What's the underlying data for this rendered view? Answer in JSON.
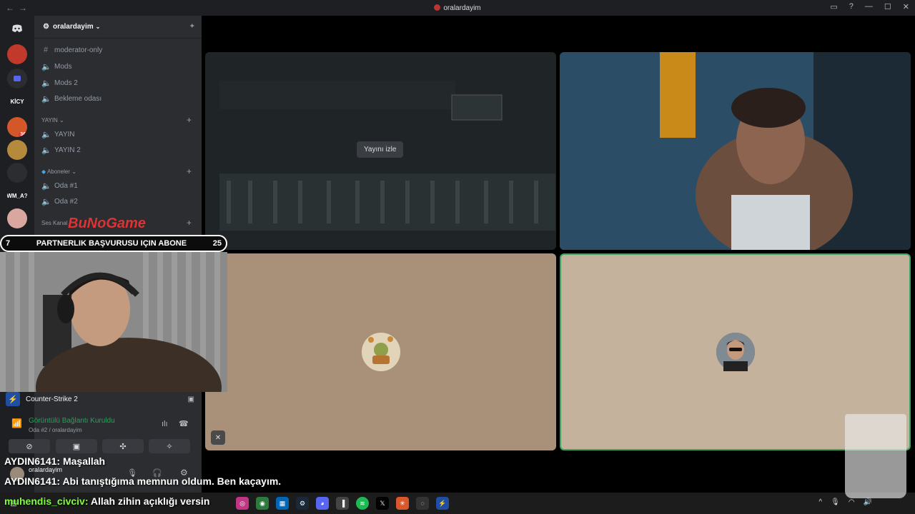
{
  "window": {
    "title": "oralardayim"
  },
  "server": {
    "name": "oralardayim"
  },
  "guilds": [
    {
      "label": "",
      "color": "#5865f2",
      "icon": "discord-icon"
    },
    {
      "label": "",
      "color": "#c0392b",
      "icon": "server-avatar"
    },
    {
      "label": "",
      "color": "#5865f2",
      "icon": "folder-icon"
    },
    {
      "label": "KİCY",
      "color": "#1e1f22",
      "icon": "server-text"
    },
    {
      "label": "36",
      "color": "#d4572a",
      "icon": "server-avatar"
    },
    {
      "label": "",
      "color": "#b58a3c",
      "icon": "server-avatar"
    },
    {
      "label": "",
      "color": "#2b2d31",
      "icon": "server-avatar"
    },
    {
      "label": "WM_A?",
      "color": "#1e1f22",
      "icon": "server-text"
    },
    {
      "label": "",
      "color": "#d9a7a0",
      "icon": "server-avatar"
    }
  ],
  "channels": {
    "top": [
      {
        "name": "moderator-only",
        "icon": "hash-icon"
      },
      {
        "name": "Mods",
        "icon": "speaker-icon"
      },
      {
        "name": "Mods 2",
        "icon": "speaker-icon"
      },
      {
        "name": "Bekleme odası",
        "icon": "speaker-icon"
      }
    ],
    "cat_yayin": "YAYIN",
    "yayin": [
      {
        "name": "YAYIN",
        "icon": "speaker-icon"
      },
      {
        "name": "YAYIN 2",
        "icon": "speaker-icon"
      }
    ],
    "cat_aboneler": "Aboneler",
    "aboneler": [
      {
        "name": "Oda #1",
        "icon": "speaker-icon"
      },
      {
        "name": "Oda #2",
        "icon": "speaker-icon"
      }
    ],
    "cat_ses": "Ses Kanal"
  },
  "stage": {
    "watch_label": "Yayını izle"
  },
  "overlay": {
    "left_num": "7",
    "text": "PARTNERLIK BAŞVURUSU IÇIN ABONE",
    "right_num": "25",
    "brand": "BuNoGame"
  },
  "activity": {
    "game": "Counter-Strike 2"
  },
  "voice": {
    "status": "Görüntülü Bağlantı Kuruldu",
    "channel": "Oda #2 / oralardayim"
  },
  "user": {
    "name": "oralardayim"
  },
  "chat": [
    {
      "text": "AYDIN6141: Maşallah"
    },
    {
      "text": "AYDIN6141: Abi tanıştığıma memnun oldum. Ben kaçayım."
    },
    {
      "user": "muhendis_civciv",
      "text": "Allah zihin açıklığı versin"
    }
  ],
  "colors": {
    "accent": "#5865f2",
    "voice_connected": "#23a55a",
    "chat_user": "#7fff3f",
    "speaking_border": "#3ba55c"
  }
}
